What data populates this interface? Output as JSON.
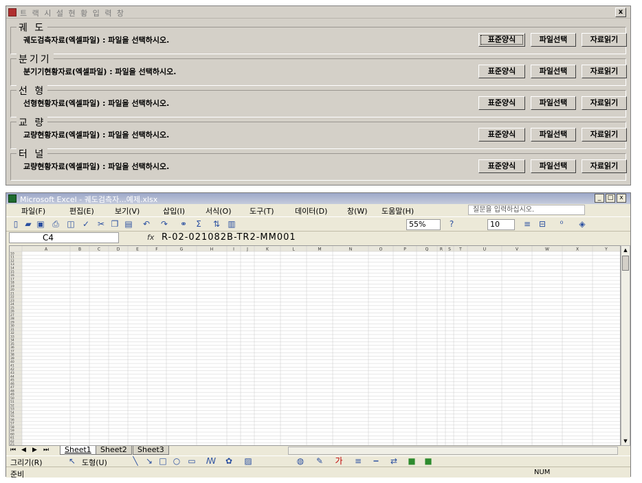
{
  "dialog": {
    "title": "트 랙 시 설 현 황 입 력 창",
    "close_label": "x",
    "groups": [
      {
        "title": "궤 도",
        "label": "궤도검측자료(엑셀파일) : 파일을 선택하시오.",
        "std": "표준양식",
        "file": "파일선택",
        "read": "자료읽기"
      },
      {
        "title": "분기기",
        "label": "분기기현황자료(엑셀파일) : 파일을 선택하시오.",
        "std": "표준양식",
        "file": "파일선택",
        "read": "자료읽기"
      },
      {
        "title": "선 형",
        "label": "선형현황자료(엑셀파일) : 파일을 선택하시오.",
        "std": "표준양식",
        "file": "파일선택",
        "read": "자료읽기"
      },
      {
        "title": "교 량",
        "label": "교량현황자료(엑셀파일) : 파일을 선택하시오.",
        "std": "표준양식",
        "file": "파일선택",
        "read": "자료읽기"
      },
      {
        "title": "터 널",
        "label": "교량현황자료(엑셀파일) : 파일을 선택하시오.",
        "std": "표준양식",
        "file": "파일선택",
        "read": "자료읽기"
      }
    ]
  },
  "excel": {
    "title": "Microsoft Excel - 궤도검측자...예제.xlsx",
    "window_buttons": [
      "_",
      "□",
      "x"
    ],
    "menu": [
      "파일(F)",
      "편집(E)",
      "보기(V)",
      "삽입(I)",
      "서식(O)",
      "도구(T)",
      "데이터(D)",
      "창(W)",
      "도움말(H)"
    ],
    "help_placeholder": "질문을 입력하십시오.",
    "zoom": "55%",
    "font_size": "10",
    "name_box": "C4",
    "fx": "fx",
    "formula": "R-02-021082B-TR2-MM001",
    "sheets": [
      "Sheet1",
      "Sheet2",
      "Sheet3"
    ],
    "draw_menu": "그리기(R)",
    "shape_menu": "도형(U)",
    "status_ready": "준비",
    "status_num": "NUM",
    "grid": {
      "first_row": 10,
      "row_count": 54,
      "columns": [
        "A",
        "B",
        "C",
        "D",
        "E",
        "F",
        "G",
        "H",
        "I",
        "J",
        "K",
        "L",
        "M",
        "N",
        "O",
        "P",
        "Q",
        "R",
        "S",
        "T",
        "U",
        "V",
        "W",
        "X",
        "Y"
      ]
    }
  }
}
